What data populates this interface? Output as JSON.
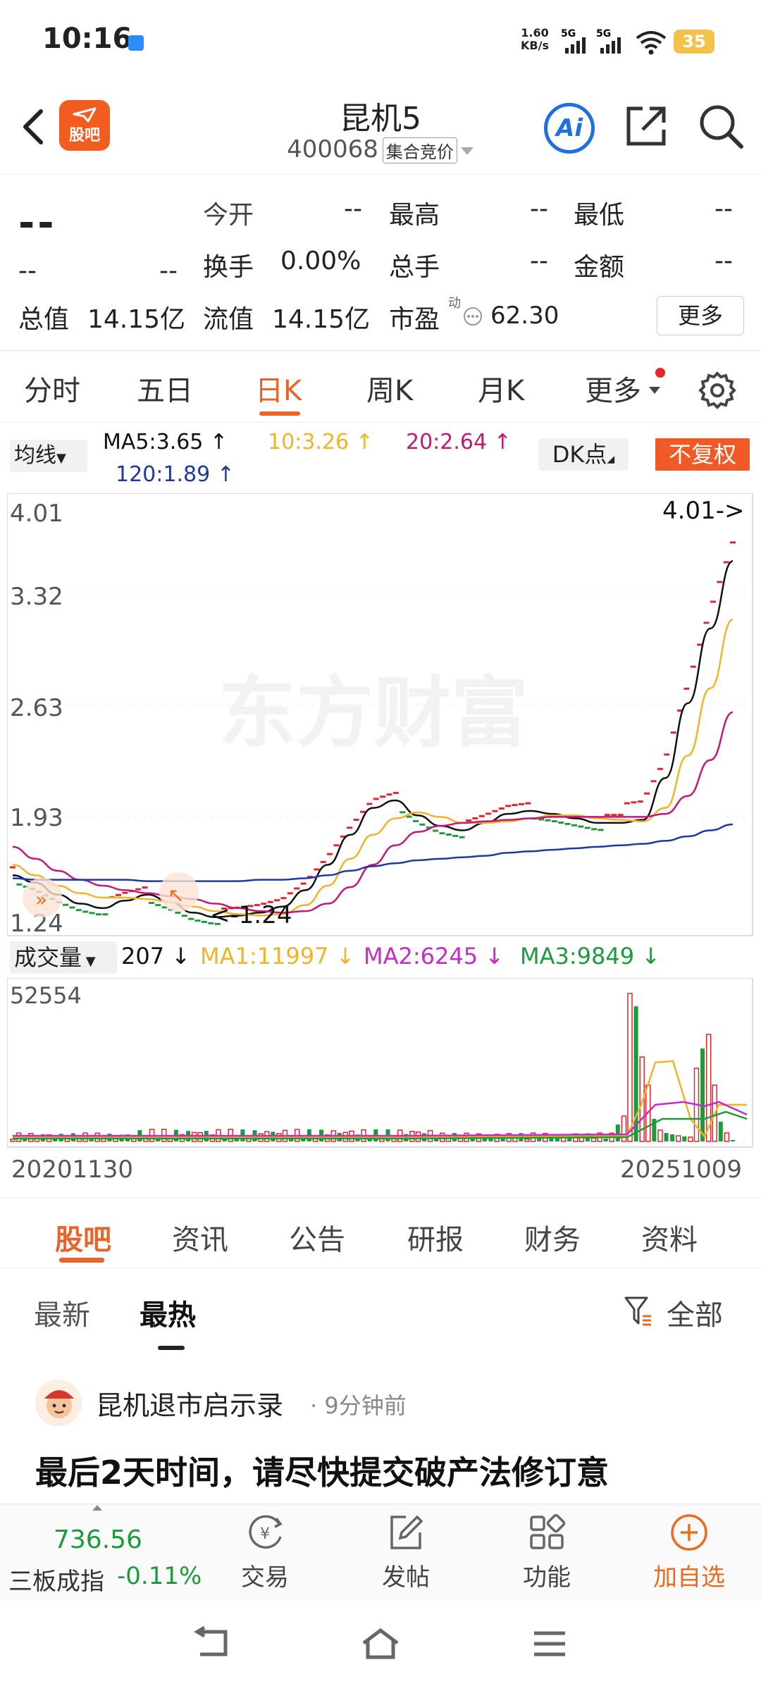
{
  "status_bar": {
    "time": "10:16",
    "net_speed_value": "1.60",
    "net_speed_unit": "KB/s",
    "signal1": "5G",
    "signal2": "5G",
    "battery": "35"
  },
  "header": {
    "logo_text": "股吧",
    "title": "昆机5",
    "code": "400068",
    "phase": "集合竞价",
    "ai_label": "Ai"
  },
  "quote": {
    "price": "--",
    "change": "--",
    "change_pct": "--",
    "open_label": "今开",
    "open": "--",
    "high_label": "最高",
    "high": "--",
    "low_label": "最低",
    "low": "--",
    "turnover_label": "换手",
    "turnover": "0.00%",
    "volume_label": "总手",
    "volume": "--",
    "amount_label": "金额",
    "amount": "--",
    "mktcap_label": "总值",
    "mktcap": "14.15亿",
    "float_label": "流值",
    "float_cap": "14.15亿",
    "pe_label": "市盈",
    "pe_sup": "动",
    "pe": "62.30",
    "more_label": "更多"
  },
  "period_tabs": {
    "items": [
      "分时",
      "五日",
      "日K",
      "周K",
      "月K",
      "更多"
    ],
    "active": "日K"
  },
  "ma_legend": {
    "selector": "均线",
    "ma5": "MA5:3.65 ↑",
    "ma10": "10:3.26 ↑",
    "ma20": "20:2.64 ↑",
    "ma120": "120:1.89 ↑",
    "dk": "DK点",
    "adjust": "不复权"
  },
  "colors": {
    "accent": "#e8642b",
    "up": "#e0262b",
    "down": "#1d9a3a",
    "ma5": "#111111",
    "ma10": "#f0b429",
    "ma20": "#c2187a",
    "ma120": "#1f3a9e"
  },
  "chart_data": [
    {
      "type": "candlestick",
      "title": "",
      "y_ticks": [
        "4.01",
        "3.32",
        "2.63",
        "1.93",
        "1.24"
      ],
      "ylim": [
        1.24,
        4.01
      ],
      "high_marker": "4.01->",
      "low_marker": "<-1.24",
      "x_start": "20201130",
      "x_end": "20251009",
      "watermark": "东方财富",
      "series": [
        {
          "name": "MA5",
          "color": "#111111",
          "values": [
            1.55,
            1.5,
            1.42,
            1.36,
            1.33,
            1.38,
            1.42,
            1.37,
            1.3,
            1.27,
            1.28,
            1.3,
            1.34,
            1.45,
            1.62,
            1.82,
            2.0,
            2.05,
            1.95,
            1.88,
            1.85,
            1.9,
            1.96,
            1.98,
            1.96,
            1.93,
            1.9,
            1.9,
            1.92,
            2.2,
            2.7,
            3.2,
            3.65
          ]
        },
        {
          "name": "MA10",
          "color": "#f0b429",
          "values": [
            1.62,
            1.55,
            1.48,
            1.43,
            1.4,
            1.4,
            1.39,
            1.37,
            1.34,
            1.31,
            1.29,
            1.28,
            1.29,
            1.35,
            1.48,
            1.66,
            1.82,
            1.93,
            1.97,
            1.94,
            1.9,
            1.9,
            1.91,
            1.93,
            1.95,
            1.95,
            1.93,
            1.92,
            1.91,
            2.0,
            2.35,
            2.8,
            3.26
          ]
        },
        {
          "name": "MA20",
          "color": "#c2187a",
          "values": [
            1.74,
            1.66,
            1.58,
            1.52,
            1.48,
            1.45,
            1.43,
            1.41,
            1.39,
            1.36,
            1.33,
            1.31,
            1.3,
            1.31,
            1.36,
            1.47,
            1.62,
            1.75,
            1.84,
            1.88,
            1.9,
            1.91,
            1.92,
            1.93,
            1.94,
            1.94,
            1.94,
            1.94,
            1.94,
            1.96,
            2.08,
            2.32,
            2.64
          ]
        },
        {
          "name": "MA120",
          "color": "#1f3a9e",
          "values": [
            1.53,
            1.52,
            1.52,
            1.52,
            1.52,
            1.52,
            1.51,
            1.51,
            1.51,
            1.51,
            1.51,
            1.52,
            1.52,
            1.53,
            1.55,
            1.58,
            1.61,
            1.63,
            1.65,
            1.66,
            1.67,
            1.68,
            1.7,
            1.71,
            1.72,
            1.73,
            1.74,
            1.75,
            1.76,
            1.78,
            1.81,
            1.85,
            1.89
          ]
        }
      ]
    },
    {
      "type": "bar",
      "title": "",
      "selector": "成交量",
      "last": "207 ↓",
      "ma1": "MA1:11997 ↓",
      "ma2": "MA2:6245 ↓",
      "ma3": "MA3:9849 ↓",
      "y_max_label": "52554",
      "ylim": [
        0,
        52554
      ]
    }
  ],
  "content_tabs": {
    "items": [
      "股吧",
      "资讯",
      "公告",
      "研报",
      "财务",
      "资料"
    ],
    "active": "股吧"
  },
  "sub_tabs": {
    "latest": "最新",
    "hot": "最热",
    "filter": "全部"
  },
  "post": {
    "author": "昆机退市启示录",
    "time": "· 9分钟前",
    "title": "最后2天时间，请尽快提交破产法修订意"
  },
  "bottom_bar": {
    "index_value": "736.56",
    "index_name": "三板成指",
    "index_change": "-0.11%",
    "trade": "交易",
    "post": "发帖",
    "function": "功能",
    "add_watch": "加自选"
  }
}
